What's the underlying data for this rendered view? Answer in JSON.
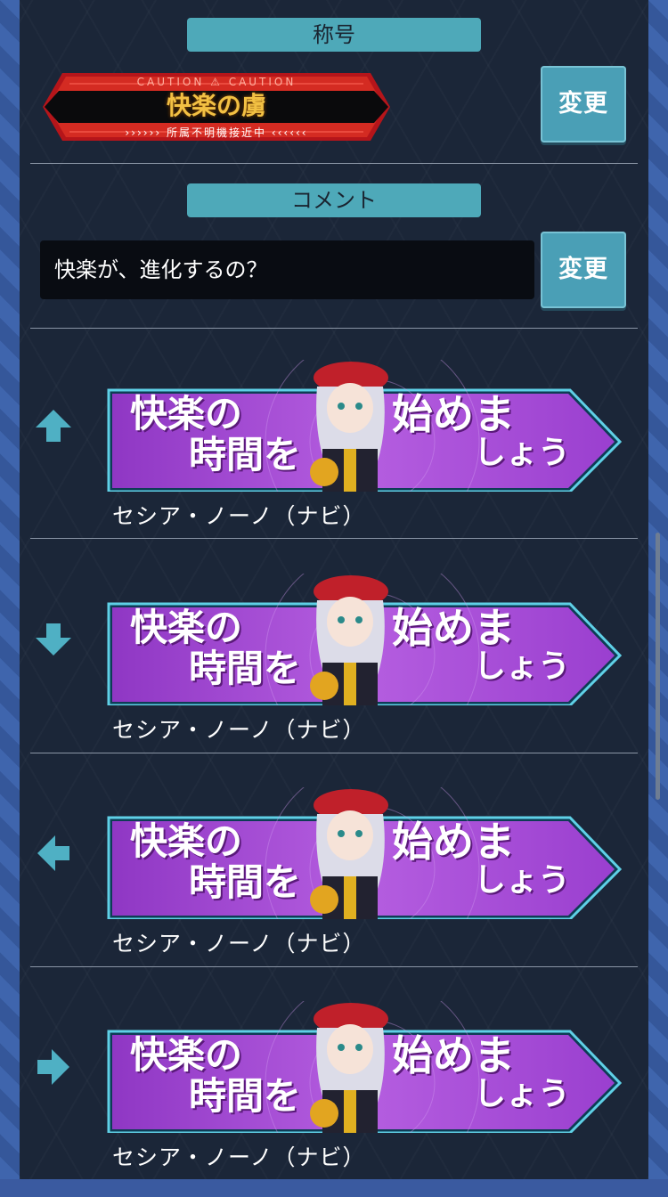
{
  "title_section": {
    "label": "称号",
    "plate": {
      "caution": "CAUTION ⚠ CAUTION",
      "title": "快楽の虜",
      "subtitle": "›››››› 所属不明機接近中 ‹‹‹‹‹‹"
    },
    "change_label": "変更"
  },
  "comment_section": {
    "label": "コメント",
    "value": "快楽が、進化するの？",
    "change_label": "変更"
  },
  "rows": [
    {
      "direction": "up",
      "icon": "arrow-up-icon",
      "banner": {
        "line1": "快楽の",
        "line2": "時間を",
        "line3": "始めま",
        "line4": "しょう"
      },
      "caption": "セシア・ノーノ（ナビ）"
    },
    {
      "direction": "down",
      "icon": "arrow-down-icon",
      "banner": {
        "line1": "快楽の",
        "line2": "時間を",
        "line3": "始めま",
        "line4": "しょう"
      },
      "caption": "セシア・ノーノ（ナビ）"
    },
    {
      "direction": "left",
      "icon": "arrow-left-icon",
      "banner": {
        "line1": "快楽の",
        "line2": "時間を",
        "line3": "始めま",
        "line4": "しょう"
      },
      "caption": "セシア・ノーノ（ナビ）"
    },
    {
      "direction": "right",
      "icon": "arrow-right-icon",
      "banner": {
        "line1": "快楽の",
        "line2": "時間を",
        "line3": "始めま",
        "line4": "しょう"
      },
      "caption": "セシア・ノーノ（ナビ）"
    }
  ],
  "colors": {
    "panel": "#1b2638",
    "accent": "#4ea9b9",
    "button": "#4a9fb6",
    "banner_purple": "#a54ad0",
    "plate_red": "#c0181c"
  }
}
